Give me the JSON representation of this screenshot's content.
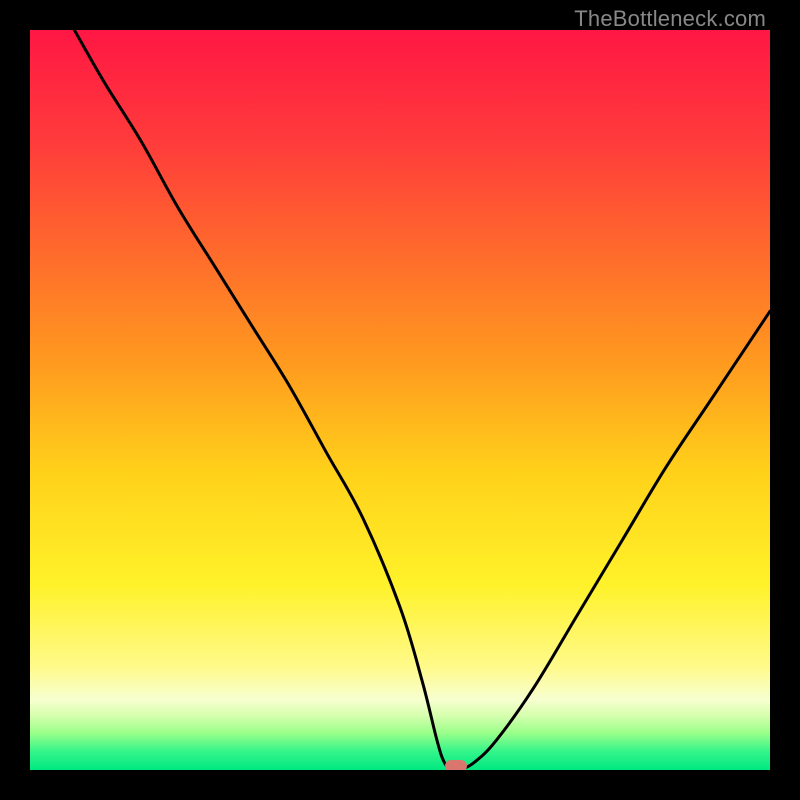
{
  "watermark": "TheBottleneck.com",
  "colors": {
    "frame": "#000000",
    "watermark_text": "#888888",
    "curve": "#000000",
    "marker": "#d9776e",
    "gradient_stops": [
      {
        "offset": 0.0,
        "color": "#ff1744"
      },
      {
        "offset": 0.15,
        "color": "#ff3b3b"
      },
      {
        "offset": 0.3,
        "color": "#ff6a2c"
      },
      {
        "offset": 0.45,
        "color": "#ff9a1f"
      },
      {
        "offset": 0.6,
        "color": "#ffd21a"
      },
      {
        "offset": 0.75,
        "color": "#fff22a"
      },
      {
        "offset": 0.86,
        "color": "#fffa8a"
      },
      {
        "offset": 0.905,
        "color": "#f7ffd0"
      },
      {
        "offset": 0.925,
        "color": "#d9ffb0"
      },
      {
        "offset": 0.95,
        "color": "#9aff8a"
      },
      {
        "offset": 0.975,
        "color": "#34f58a"
      },
      {
        "offset": 1.0,
        "color": "#00e881"
      }
    ]
  },
  "chart_data": {
    "type": "line",
    "title": "",
    "xlabel": "",
    "ylabel": "",
    "xlim": [
      0,
      100
    ],
    "ylim": [
      0,
      100
    ],
    "grid": false,
    "series": [
      {
        "name": "bottleneck-curve",
        "x": [
          6,
          10,
          15,
          20,
          25,
          30,
          35,
          40,
          45,
          50,
          53,
          55,
          56,
          57,
          58,
          60,
          63,
          68,
          74,
          80,
          86,
          92,
          98,
          100
        ],
        "values": [
          100,
          93,
          85,
          76,
          68,
          60,
          52,
          43,
          34,
          22,
          12,
          4,
          1,
          0,
          0,
          1,
          4,
          11,
          21,
          31,
          41,
          50,
          59,
          62
        ]
      }
    ],
    "annotations": [
      {
        "type": "marker",
        "name": "optimal-point",
        "x": 57.5,
        "y": 0
      }
    ]
  }
}
